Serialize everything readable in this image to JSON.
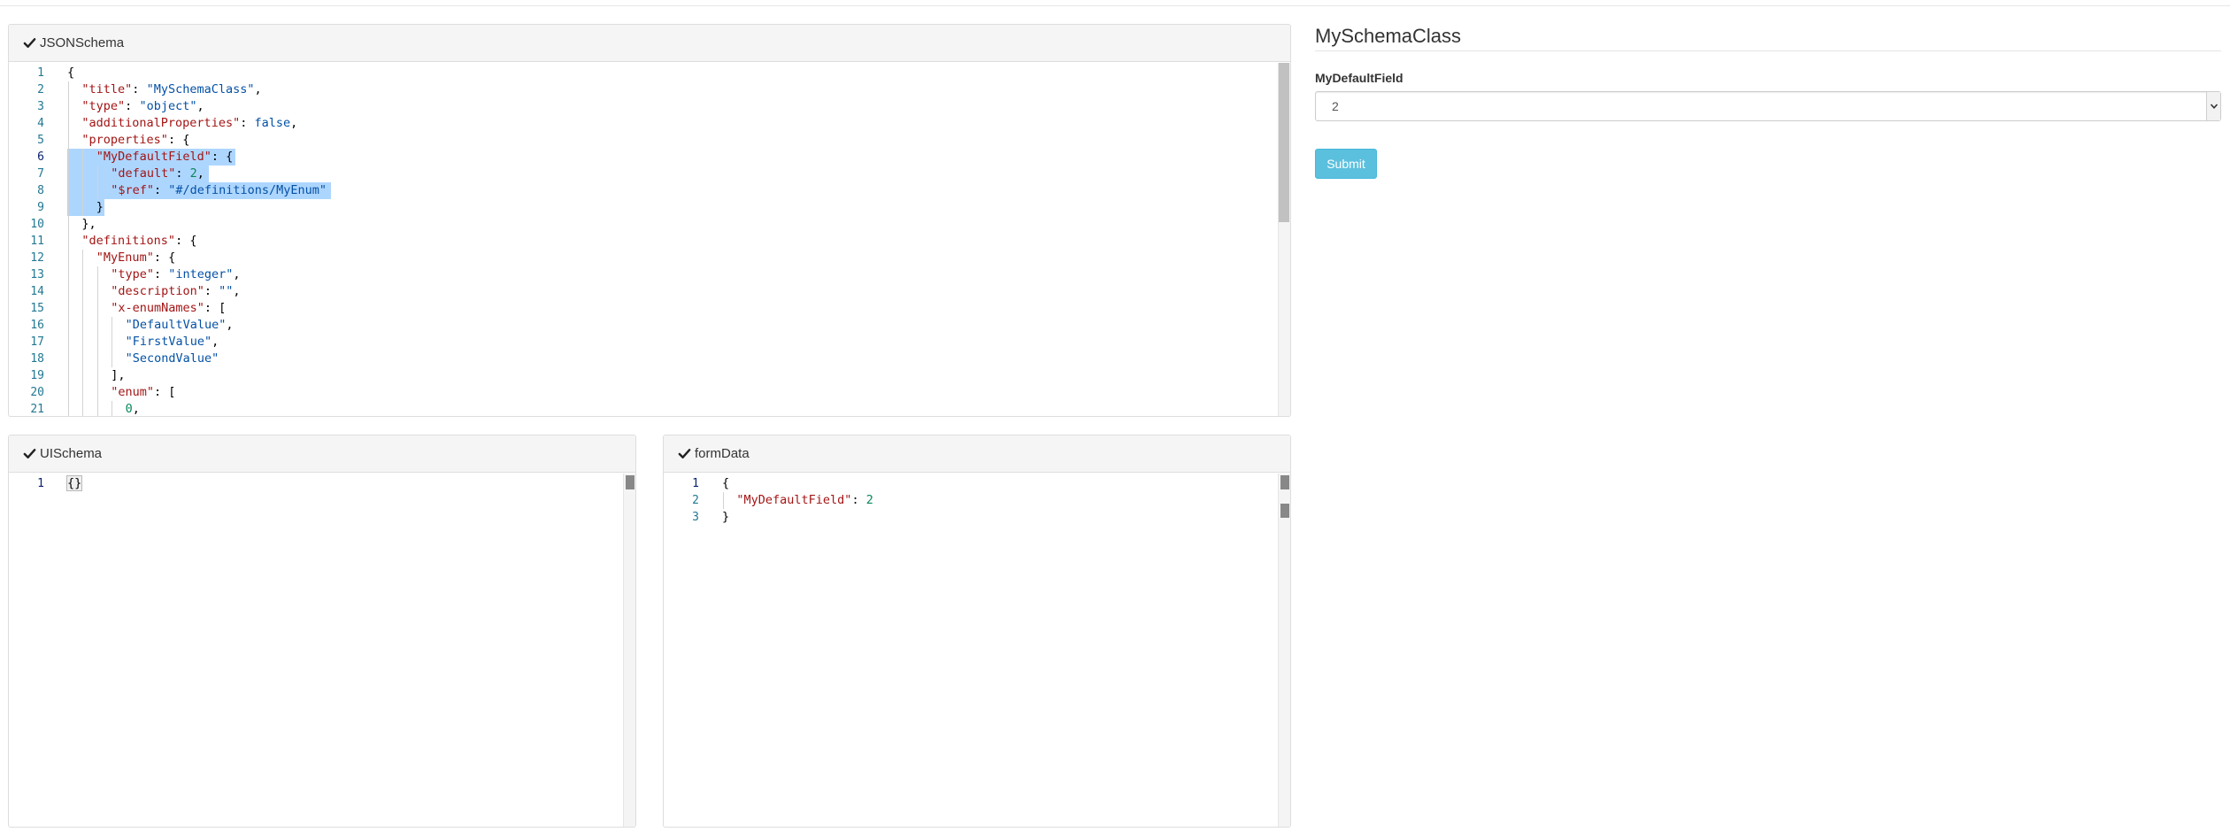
{
  "panels": {
    "jsonschema": {
      "title": "JSONSchema"
    },
    "uischema": {
      "title": "UISchema"
    },
    "formdata": {
      "title": "formData"
    }
  },
  "jsonschema_lines": [
    {
      "n": "1",
      "indent": 0,
      "tokens": [
        [
          "p",
          "{"
        ]
      ]
    },
    {
      "n": "2",
      "indent": 1,
      "tokens": [
        [
          "k",
          "\"title\""
        ],
        [
          "p",
          ": "
        ],
        [
          "s",
          "\"MySchemaClass\""
        ],
        [
          "p",
          ","
        ]
      ]
    },
    {
      "n": "3",
      "indent": 1,
      "tokens": [
        [
          "k",
          "\"type\""
        ],
        [
          "p",
          ": "
        ],
        [
          "s",
          "\"object\""
        ],
        [
          "p",
          ","
        ]
      ]
    },
    {
      "n": "4",
      "indent": 1,
      "tokens": [
        [
          "k",
          "\"additionalProperties\""
        ],
        [
          "p",
          ": "
        ],
        [
          "w",
          "false"
        ],
        [
          "p",
          ","
        ]
      ]
    },
    {
      "n": "5",
      "indent": 1,
      "tokens": [
        [
          "k",
          "\"properties\""
        ],
        [
          "p",
          ": {"
        ]
      ]
    },
    {
      "n": "6",
      "indent": 2,
      "tokens": [
        [
          "k",
          "\"MyDefaultField\""
        ],
        [
          "p",
          ": {"
        ]
      ]
    },
    {
      "n": "7",
      "indent": 3,
      "tokens": [
        [
          "k",
          "\"default\""
        ],
        [
          "p",
          ": "
        ],
        [
          "n",
          "2"
        ],
        [
          "p",
          ","
        ]
      ]
    },
    {
      "n": "8",
      "indent": 3,
      "tokens": [
        [
          "k",
          "\"$ref\""
        ],
        [
          "p",
          ": "
        ],
        [
          "s",
          "\"#/definitions/MyEnum\""
        ]
      ]
    },
    {
      "n": "9",
      "indent": 2,
      "tokens": [
        [
          "p",
          "}"
        ]
      ]
    },
    {
      "n": "10",
      "indent": 1,
      "tokens": [
        [
          "p",
          "},"
        ]
      ]
    },
    {
      "n": "11",
      "indent": 1,
      "tokens": [
        [
          "k",
          "\"definitions\""
        ],
        [
          "p",
          ": {"
        ]
      ]
    },
    {
      "n": "12",
      "indent": 2,
      "tokens": [
        [
          "k",
          "\"MyEnum\""
        ],
        [
          "p",
          ": {"
        ]
      ]
    },
    {
      "n": "13",
      "indent": 3,
      "tokens": [
        [
          "k",
          "\"type\""
        ],
        [
          "p",
          ": "
        ],
        [
          "s",
          "\"integer\""
        ],
        [
          "p",
          ","
        ]
      ]
    },
    {
      "n": "14",
      "indent": 3,
      "tokens": [
        [
          "k",
          "\"description\""
        ],
        [
          "p",
          ": "
        ],
        [
          "s",
          "\"\""
        ],
        [
          "p",
          ","
        ]
      ]
    },
    {
      "n": "15",
      "indent": 3,
      "tokens": [
        [
          "k",
          "\"x-enumNames\""
        ],
        [
          "p",
          ": ["
        ]
      ]
    },
    {
      "n": "16",
      "indent": 4,
      "tokens": [
        [
          "s",
          "\"DefaultValue\""
        ],
        [
          "p",
          ","
        ]
      ]
    },
    {
      "n": "17",
      "indent": 4,
      "tokens": [
        [
          "s",
          "\"FirstValue\""
        ],
        [
          "p",
          ","
        ]
      ]
    },
    {
      "n": "18",
      "indent": 4,
      "tokens": [
        [
          "s",
          "\"SecondValue\""
        ]
      ]
    },
    {
      "n": "19",
      "indent": 3,
      "tokens": [
        [
          "p",
          "],"
        ]
      ]
    },
    {
      "n": "20",
      "indent": 3,
      "tokens": [
        [
          "k",
          "\"enum\""
        ],
        [
          "p",
          ": ["
        ]
      ]
    },
    {
      "n": "21",
      "indent": 4,
      "tokens": [
        [
          "n",
          "0"
        ],
        [
          "p",
          ","
        ]
      ]
    }
  ],
  "uischema_lines": [
    {
      "n": "1",
      "indent": 0,
      "tokens": [
        [
          "p",
          "{}"
        ]
      ]
    }
  ],
  "formdata_lines": [
    {
      "n": "1",
      "indent": 0,
      "tokens": [
        [
          "p",
          "{"
        ]
      ]
    },
    {
      "n": "2",
      "indent": 1,
      "tokens": [
        [
          "k",
          "\"MyDefaultField\""
        ],
        [
          "p",
          ": "
        ],
        [
          "n",
          "2"
        ]
      ]
    },
    {
      "n": "3",
      "indent": 0,
      "tokens": [
        [
          "p",
          "}"
        ]
      ]
    }
  ],
  "form": {
    "title": "MySchemaClass",
    "field_label": "MyDefaultField",
    "selected_value": "2",
    "submit_label": "Submit"
  },
  "colors": {
    "submit_bg": "#5bc0de",
    "selection": "#add6ff",
    "key": "#a31515",
    "string": "#0451a5",
    "number": "#098658"
  }
}
